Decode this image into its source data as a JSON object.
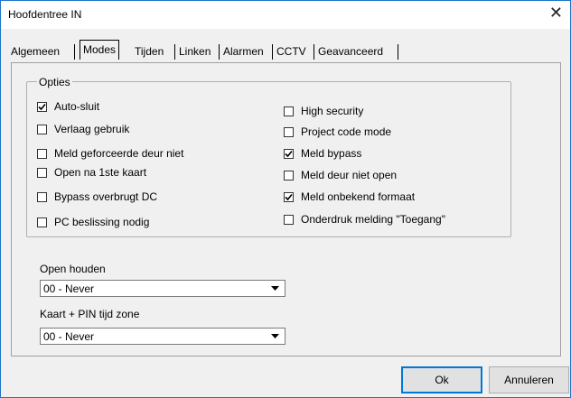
{
  "window": {
    "title": "Hoofdentree IN",
    "close_glyph": "✕"
  },
  "tabs": [
    {
      "label": "Algemeen",
      "active": false
    },
    {
      "label": "Modes",
      "active": true
    },
    {
      "label": "Tijden",
      "active": false
    },
    {
      "label": "Linken",
      "active": false
    },
    {
      "label": "Alarmen",
      "active": false
    },
    {
      "label": "CCTV",
      "active": false
    },
    {
      "label": "Geavanceerd",
      "active": false
    }
  ],
  "options": {
    "legend": "Opties",
    "left": [
      {
        "label": "Auto-sluit",
        "checked": true
      },
      {
        "label": "Verlaag gebruik",
        "checked": false
      },
      {
        "label": "Meld geforceerde deur niet",
        "checked": false
      },
      {
        "label": "Open na 1ste kaart",
        "checked": false
      },
      {
        "label": "Bypass overbrugt DC",
        "checked": false
      },
      {
        "label": "PC beslissing nodig",
        "checked": false
      }
    ],
    "right": [
      {
        "label": "High security",
        "checked": false
      },
      {
        "label": "Project code mode",
        "checked": false
      },
      {
        "label": "Meld bypass",
        "checked": true
      },
      {
        "label": "Meld deur niet open",
        "checked": false
      },
      {
        "label": "Meld onbekend formaat",
        "checked": true
      },
      {
        "label": "Onderdruk melding \"Toegang\"",
        "checked": false
      }
    ]
  },
  "open_houden": {
    "label": "Open houden",
    "value": "00 - Never"
  },
  "pin_zone": {
    "label": "Kaart + PIN tijd zone",
    "value": "00 - Never"
  },
  "buttons": {
    "ok": "Ok",
    "cancel": "Annuleren"
  },
  "colors": {
    "accent": "#0078d7",
    "window_border": "#1e73c7",
    "background": "#f0f0f0"
  }
}
